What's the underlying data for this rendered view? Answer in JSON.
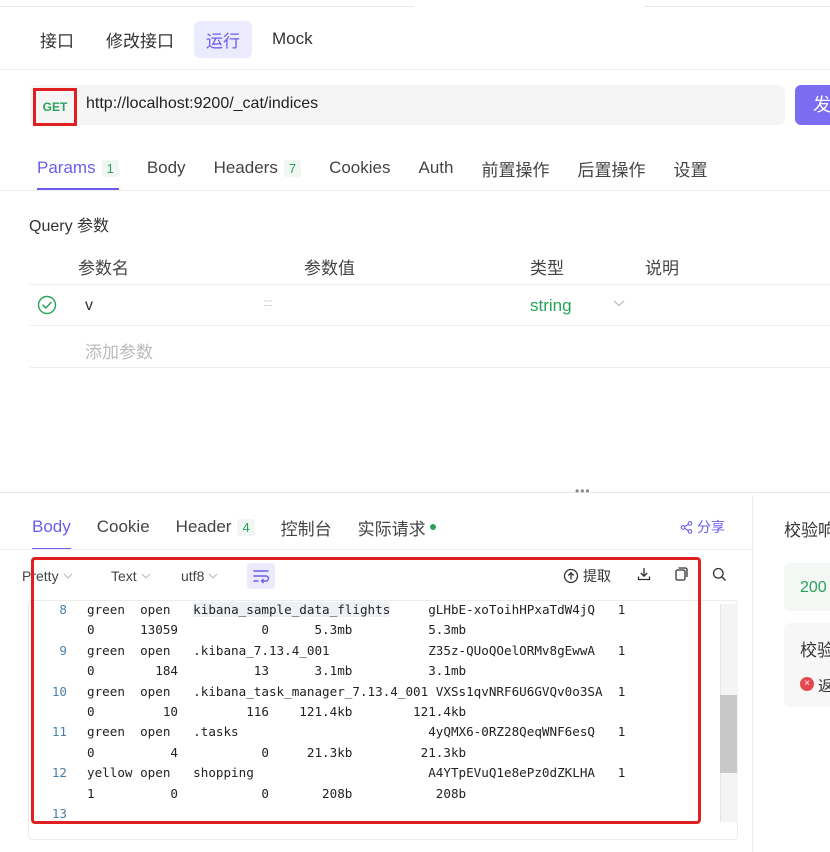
{
  "top_tabs": [
    "接口",
    "修改接口",
    "运行",
    "Mock"
  ],
  "active_top_tab": "运行",
  "request": {
    "method": "GET",
    "url": "http://localhost:9200/_cat/indices",
    "send_label": "发"
  },
  "request_tabs": [
    {
      "label": "Params",
      "count": "1"
    },
    {
      "label": "Body",
      "count": ""
    },
    {
      "label": "Headers",
      "count": "7"
    },
    {
      "label": "Cookies",
      "count": ""
    },
    {
      "label": "Auth",
      "count": ""
    },
    {
      "label": "前置操作",
      "count": ""
    },
    {
      "label": "后置操作",
      "count": ""
    },
    {
      "label": "设置",
      "count": ""
    }
  ],
  "query": {
    "title": "Query 参数",
    "columns": [
      "参数名",
      "参数值",
      "类型",
      "说明"
    ],
    "rows": [
      {
        "name": "v",
        "value": "",
        "type": "string"
      }
    ],
    "add_placeholder": "添加参数"
  },
  "response_tabs": [
    {
      "label": "Body",
      "count": ""
    },
    {
      "label": "Cookie",
      "count": ""
    },
    {
      "label": "Header",
      "count": "4"
    },
    {
      "label": "控制台",
      "count": ""
    },
    {
      "label": "实际请求",
      "count": ""
    }
  ],
  "share_label": "分享",
  "toolbar": {
    "format": "Pretty",
    "type": "Text",
    "encoding": "utf8",
    "extract_label": "提取"
  },
  "code_lines": [
    {
      "ln": "8",
      "text": "green  open   kibana_sample_data_flights     gLHbE-xoToihHPxaTdW4jQ   1"
    },
    {
      "ln": "",
      "text": "0      13059           0      5.3mb          5.3mb"
    },
    {
      "ln": "9",
      "text": "green  open   .kibana_7.13.4_001             Z35z-QUoQOelORMv8gEwwA   1"
    },
    {
      "ln": "",
      "text": "0        184          13      3.1mb          3.1mb"
    },
    {
      "ln": "10",
      "text": "green  open   .kibana_task_manager_7.13.4_001 VXSs1qvNRF6U6GVQv0o3SA  1"
    },
    {
      "ln": "",
      "text": "0         10         116    121.4kb        121.4kb"
    },
    {
      "ln": "11",
      "text": "green  open   .tasks                         4yQMX6-0RZ28QeqWNF6esQ   1"
    },
    {
      "ln": "",
      "text": "0          4           0     21.3kb         21.3kb"
    },
    {
      "ln": "12",
      "text": "yellow open   shopping                       A4YTpEVuQ1e8ePz0dZKLHA   1"
    },
    {
      "ln": "",
      "text": "1          0           0       208b           208b"
    },
    {
      "ln": "13",
      "text": ""
    }
  ],
  "right_panel": {
    "title": "校验响",
    "status_code": "200",
    "verify_label": "校验",
    "error_text": "返"
  },
  "colors": {
    "accent": "#6b5cf0",
    "success": "#29a35a",
    "highlight_box": "#e02020"
  }
}
